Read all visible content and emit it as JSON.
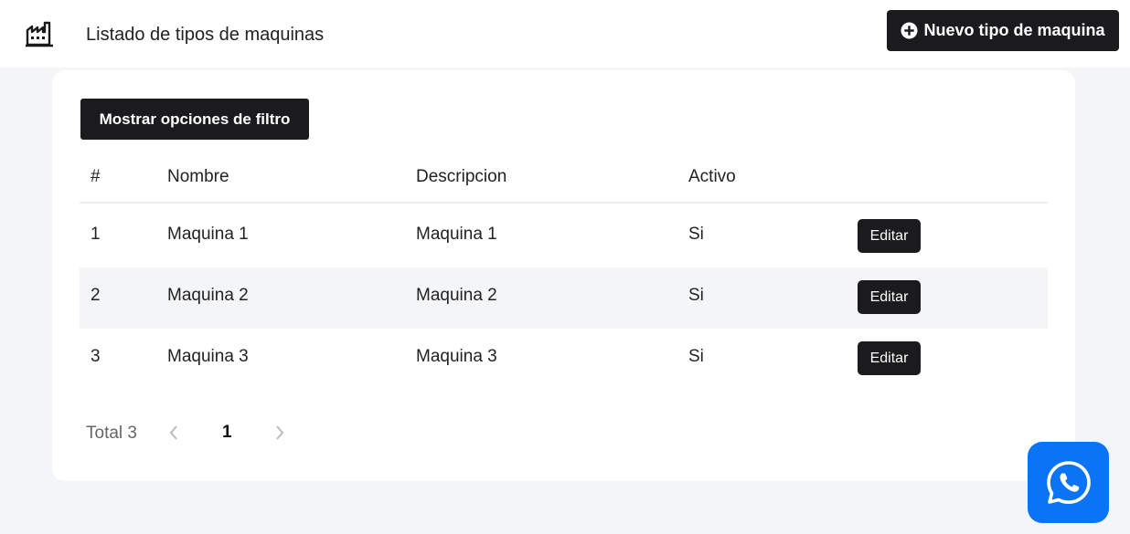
{
  "header": {
    "icon": "factory-icon",
    "title": "Listado de tipos de maquinas",
    "new_button_label": "Nuevo tipo de maquina",
    "new_button_icon": "plus-circle-icon"
  },
  "filter": {
    "button_label": "Mostrar opciones de filtro"
  },
  "table": {
    "columns": [
      "#",
      "Nombre",
      "Descripcion",
      "Activo"
    ],
    "rows": [
      {
        "id": "1",
        "nombre": "Maquina 1",
        "descripcion": "Maquina 1",
        "activo": "Si",
        "action": "Editar"
      },
      {
        "id": "2",
        "nombre": "Maquina 2",
        "descripcion": "Maquina 2",
        "activo": "Si",
        "action": "Editar"
      },
      {
        "id": "3",
        "nombre": "Maquina 3",
        "descripcion": "Maquina 3",
        "activo": "Si",
        "action": "Editar"
      }
    ]
  },
  "pagination": {
    "total_label": "Total 3",
    "current_page": "1"
  },
  "colors": {
    "primary_dark": "#1b1b1d",
    "whatsapp_blue": "#0b74f5",
    "page_bg": "#f4f5f7"
  },
  "floating": {
    "icon": "whatsapp-icon"
  }
}
